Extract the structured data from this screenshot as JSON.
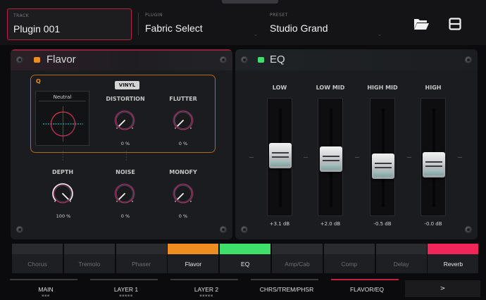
{
  "header": {
    "track_caption": "TRACK",
    "track_value": "Plugin 001",
    "plugin_caption": "PLUGIN",
    "plugin_value": "Fabric Select",
    "preset_caption": "PRESET",
    "preset_value": "Studio Grand",
    "folder_icon": "folder-open-icon",
    "save_icon": "save-icon"
  },
  "flavor": {
    "title": "Flavor",
    "led_color": "#f08d21",
    "q_label": "Q",
    "vinyl_label": "VINYL",
    "display_caption": "Neutral",
    "knobs": {
      "distortion": {
        "label": "DISTORTION",
        "value": "0 %",
        "level": 0
      },
      "flutter": {
        "label": "FLUTTER",
        "value": "0 %",
        "level": 0
      },
      "depth": {
        "label": "DEPTH",
        "value": "100 %",
        "level": 1
      },
      "noise": {
        "label": "NOISE",
        "value": "0 %",
        "level": 0
      },
      "monofy": {
        "label": "MONOFY",
        "value": "0 %",
        "level": 0
      }
    }
  },
  "eq": {
    "title": "EQ",
    "led_color": "#3fe06a",
    "bands": [
      {
        "label": "LOW",
        "value": "+3.1 dB",
        "db": 3.1
      },
      {
        "label": "LOW MID",
        "value": "+2.0 dB",
        "db": 2.0
      },
      {
        "label": "HIGH MID",
        "value": "-0.5 dB",
        "db": -0.5
      },
      {
        "label": "HIGH",
        "value": "-0.0 dB",
        "db": 0.0
      }
    ]
  },
  "modules": [
    {
      "label": "Chorus",
      "on": false,
      "color": ""
    },
    {
      "label": "Tremolo",
      "on": false,
      "color": ""
    },
    {
      "label": "Phaser",
      "on": false,
      "color": ""
    },
    {
      "label": "Flavor",
      "on": true,
      "color": "#f08d21"
    },
    {
      "label": "EQ",
      "on": true,
      "color": "#3fe06a"
    },
    {
      "label": "Amp/Cab",
      "on": false,
      "color": ""
    },
    {
      "label": "Comp",
      "on": false,
      "color": ""
    },
    {
      "label": "Delay",
      "on": false,
      "color": ""
    },
    {
      "label": "Reverb",
      "on": true,
      "color": "#f0255a"
    }
  ],
  "tabs": [
    {
      "label": "MAIN",
      "dots": "▪▪▪",
      "active": false
    },
    {
      "label": "LAYER 1",
      "dots": "▪▪▪▪▪",
      "active": false
    },
    {
      "label": "LAYER 2",
      "dots": "▪▪▪▪▪",
      "active": false
    },
    {
      "label": "CHRS/TREM/PHSR",
      "dots": "",
      "active": false
    },
    {
      "label": "FLAVOR/EQ",
      "dots": "",
      "active": true
    }
  ],
  "more_tab_label": ">"
}
